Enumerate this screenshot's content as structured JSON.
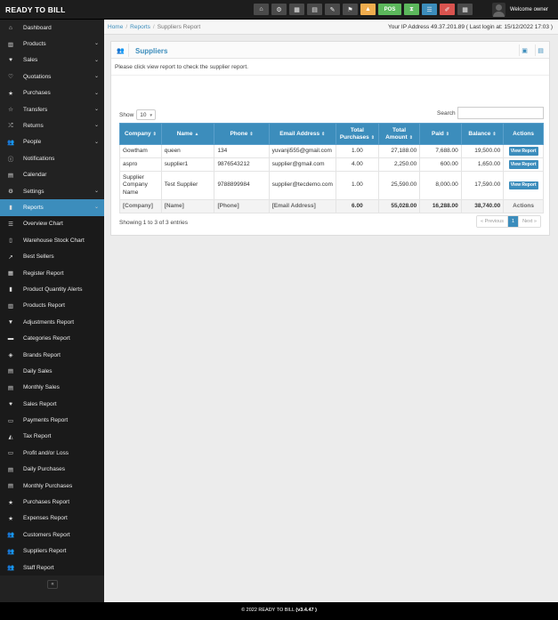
{
  "app": {
    "brand": "READY TO BILL",
    "welcome": "Welcome owner"
  },
  "topbar": {
    "buttons": [
      {
        "icon": "dashboard-icon",
        "glyph": "⌂"
      },
      {
        "icon": "settings-icon",
        "glyph": "⚙"
      },
      {
        "icon": "calculator-icon",
        "glyph": "▦"
      },
      {
        "icon": "calendar-icon",
        "glyph": "▤"
      },
      {
        "icon": "edit-icon",
        "glyph": "✎"
      },
      {
        "icon": "flag-icon",
        "glyph": "⚑"
      },
      {
        "icon": "alert-icon",
        "glyph": "▲"
      },
      {
        "icon": "pos-button",
        "glyph": "POS"
      },
      {
        "icon": "hourglass-icon",
        "glyph": "⧗"
      },
      {
        "icon": "list-icon",
        "glyph": "☰"
      },
      {
        "icon": "flame-icon",
        "glyph": "✐"
      },
      {
        "icon": "grid-icon",
        "glyph": "▦"
      }
    ]
  },
  "sidebar": {
    "items": [
      {
        "label": "Dashboard",
        "icon": "dashboard-icon",
        "glyph": "⌂",
        "chev": false
      },
      {
        "label": "Products",
        "icon": "barcode-icon",
        "glyph": "▥",
        "chev": true
      },
      {
        "label": "Sales",
        "icon": "heart-icon",
        "glyph": "♥",
        "chev": true
      },
      {
        "label": "Quotations",
        "icon": "heart-outline-icon",
        "glyph": "♡",
        "chev": true
      },
      {
        "label": "Purchases",
        "icon": "star-icon",
        "glyph": "★",
        "chev": true
      },
      {
        "label": "Transfers",
        "icon": "star-outline-icon",
        "glyph": "☆",
        "chev": true
      },
      {
        "label": "Returns",
        "icon": "random-icon",
        "glyph": "⤮",
        "chev": true
      },
      {
        "label": "People",
        "icon": "users-icon",
        "glyph": "👥",
        "chev": true
      },
      {
        "label": "Notifications",
        "icon": "info-icon",
        "glyph": "ⓘ",
        "chev": false
      },
      {
        "label": "Calendar",
        "icon": "calendar-icon",
        "glyph": "▤",
        "chev": false
      },
      {
        "label": "Settings",
        "icon": "cog-icon",
        "glyph": "⚙",
        "chev": true
      },
      {
        "label": "Reports",
        "icon": "bar-chart-icon",
        "glyph": "▮",
        "chev": true,
        "active": true
      },
      {
        "label": "Overview Chart",
        "icon": "list-icon",
        "glyph": "☰",
        "sub": true
      },
      {
        "label": "Warehouse Stock Chart",
        "icon": "building-icon",
        "glyph": "▯",
        "sub": true
      },
      {
        "label": "Best Sellers",
        "icon": "line-chart-icon",
        "glyph": "↗",
        "sub": true
      },
      {
        "label": "Register Report",
        "icon": "th-icon",
        "glyph": "▦",
        "sub": true
      },
      {
        "label": "Product Quantity Alerts",
        "icon": "bar-chart-icon",
        "glyph": "▮",
        "sub": true
      },
      {
        "label": "Products Report",
        "icon": "barcode-icon",
        "glyph": "▥",
        "sub": true
      },
      {
        "label": "Adjustments Report",
        "icon": "filter-icon",
        "glyph": "▼",
        "sub": true
      },
      {
        "label": "Categories Report",
        "icon": "folder-icon",
        "glyph": "▬",
        "sub": true
      },
      {
        "label": "Brands Report",
        "icon": "cubes-icon",
        "glyph": "◈",
        "sub": true
      },
      {
        "label": "Daily Sales",
        "icon": "calendar-icon",
        "glyph": "▤",
        "sub": true
      },
      {
        "label": "Monthly Sales",
        "icon": "calendar-icon",
        "glyph": "▤",
        "sub": true
      },
      {
        "label": "Sales Report",
        "icon": "heart-icon",
        "glyph": "♥",
        "sub": true
      },
      {
        "label": "Payments Report",
        "icon": "money-icon",
        "glyph": "▭",
        "sub": true
      },
      {
        "label": "Tax Report",
        "icon": "area-chart-icon",
        "glyph": "◭",
        "sub": true
      },
      {
        "label": "Profit and/or Loss",
        "icon": "money-icon",
        "glyph": "▭",
        "sub": true
      },
      {
        "label": "Daily Purchases",
        "icon": "calendar-icon",
        "glyph": "▤",
        "sub": true
      },
      {
        "label": "Monthly Purchases",
        "icon": "calendar-icon",
        "glyph": "▤",
        "sub": true
      },
      {
        "label": "Purchases Report",
        "icon": "star-icon",
        "glyph": "★",
        "sub": true
      },
      {
        "label": "Expenses Report",
        "icon": "star-icon",
        "glyph": "★",
        "sub": true
      },
      {
        "label": "Customers Report",
        "icon": "users-icon",
        "glyph": "👥",
        "sub": true
      },
      {
        "label": "Suppliers Report",
        "icon": "users-icon",
        "glyph": "👥",
        "sub": true
      },
      {
        "label": "Staff Report",
        "icon": "users-icon",
        "glyph": "👥",
        "sub": true
      }
    ],
    "collapse": "«"
  },
  "breadcrumb": {
    "home": "Home",
    "reports": "Reports",
    "current": "Suppliers Report"
  },
  "ip_info": "Your IP Address 49.37.201.89 ( Last login at: 15/12/2022 17:03 )",
  "box": {
    "title": "Suppliers",
    "intro": "Please click view report to check the supplier report."
  },
  "controls": {
    "show_label": "Show",
    "page_size": "10",
    "search_label": "Search",
    "search_value": ""
  },
  "table": {
    "headers": [
      "Company",
      "Name",
      "Phone",
      "Email Address",
      "Total Purchases",
      "Total Amount",
      "Paid",
      "Balance",
      "Actions"
    ],
    "rows": [
      {
        "company": "Gowtham",
        "name": "queen",
        "phone": "134",
        "email": "yuvanji555@gmail.com",
        "total_purchases": "1.00",
        "total_amount": "27,188.00",
        "paid": "7,688.00",
        "balance": "19,500.00",
        "action": "View Report"
      },
      {
        "company": "aspro",
        "name": "supplier1",
        "phone": "9876543212",
        "email": "supplier@gmail.com",
        "total_purchases": "4.00",
        "total_amount": "2,250.00",
        "paid": "600.00",
        "balance": "1,650.00",
        "action": "View Report"
      },
      {
        "company": "Supplier Company Name",
        "name": "Test Supplier",
        "phone": "9788899984",
        "email": "supplier@tecdemo.com",
        "total_purchases": "1.00",
        "total_amount": "25,590.00",
        "paid": "8,000.00",
        "balance": "17,590.00",
        "action": "View Report"
      }
    ],
    "footer": {
      "company": "[Company]",
      "name": "[Name]",
      "phone": "[Phone]",
      "email": "[Email Address]",
      "total_purchases": "6.00",
      "total_amount": "55,028.00",
      "paid": "16,288.00",
      "balance": "38,740.00",
      "actions": "Actions"
    }
  },
  "pagination": {
    "info": "Showing 1 to 3 of 3 entries",
    "previous": "« Previous",
    "current": "1",
    "next": "Next »"
  },
  "footer": {
    "text": "© 2022 READY TO BILL ",
    "version": "(v3.4.47 )"
  }
}
